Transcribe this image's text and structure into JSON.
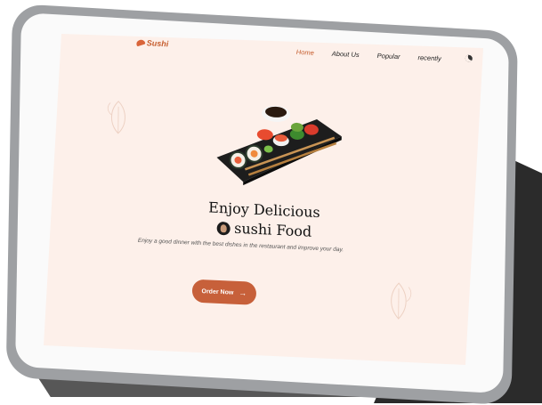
{
  "logo": {
    "text": "Sushi"
  },
  "nav": {
    "items": [
      {
        "label": "Home",
        "active": true
      },
      {
        "label": "About Us",
        "active": false
      },
      {
        "label": "Popular",
        "active": false
      },
      {
        "label": "recently",
        "active": false
      }
    ],
    "theme_icon": "moon-icon"
  },
  "hero": {
    "title_line1": "Enjoy Delicious",
    "title_line2": "sushi Food",
    "description": "Enjoy a good dinner with the best dishes in the restaurant and improve your day.",
    "cta_label": "Order Now",
    "cta_icon": "arrow-right-icon"
  },
  "colors": {
    "accent": "#c7603a",
    "screen_bg": "#fdf0ea",
    "device_frame": "#9ea0a3",
    "stand": "#2b2b2b"
  }
}
